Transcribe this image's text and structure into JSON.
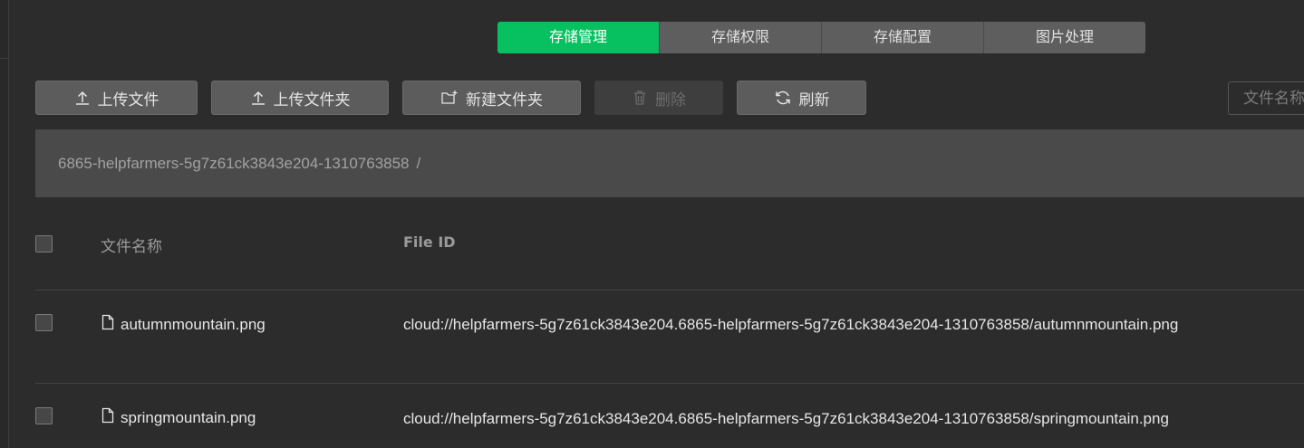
{
  "tabs": [
    {
      "label": "存储管理",
      "active": true
    },
    {
      "label": "存储权限",
      "active": false
    },
    {
      "label": "存储配置",
      "active": false
    },
    {
      "label": "图片处理",
      "active": false
    }
  ],
  "toolbar": {
    "upload_file": "上传文件",
    "upload_folder": "上传文件夹",
    "new_folder": "新建文件夹",
    "delete": "删除",
    "refresh": "刷新"
  },
  "search": {
    "placeholder": "文件名称"
  },
  "breadcrumb": {
    "path": "6865-helpfarmers-5g7z61ck3843e204-1310763858",
    "separator": "/"
  },
  "table": {
    "headers": {
      "name": "文件名称",
      "file_id": "File ID"
    },
    "rows": [
      {
        "name": "autumnmountain.png",
        "file_id": "cloud://helpfarmers-5g7z61ck3843e204.6865-helpfarmers-5g7z61ck3843e204-1310763858/autumnmountain.png"
      },
      {
        "name": "springmountain.png",
        "file_id": "cloud://helpfarmers-5g7z61ck3843e204.6865-helpfarmers-5g7z61ck3843e204-1310763858/springmountain.png"
      }
    ]
  },
  "colors": {
    "accent": "#07c160",
    "background": "#2c2c2c"
  }
}
